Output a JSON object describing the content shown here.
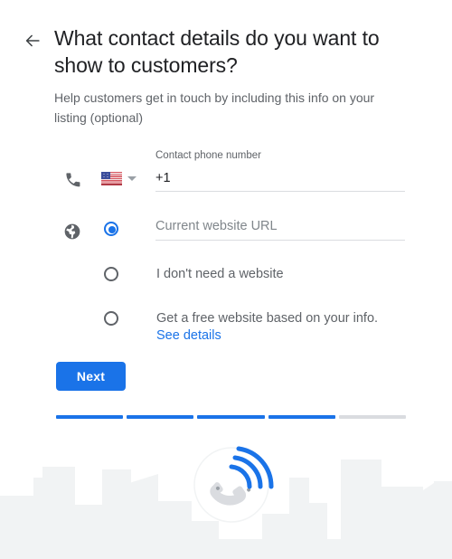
{
  "header": {
    "back_icon": "arrow-left-icon",
    "title": "What contact details do you want to show to customers?",
    "subtitle": "Help customers get in touch by including this info on your listing (optional)"
  },
  "phone": {
    "lead_icon": "phone-icon",
    "country_flag": "us-flag-icon",
    "country_caret": "chevron-down-icon",
    "label": "Contact phone number",
    "value": "+1"
  },
  "website": {
    "lead_icon": "globe-icon",
    "options": [
      {
        "id": "current-url",
        "type": "input",
        "selected": true,
        "placeholder": "Current website URL",
        "label": ""
      },
      {
        "id": "no-website",
        "type": "label",
        "selected": false,
        "label": "I don't need a website"
      },
      {
        "id": "free-website",
        "type": "label-link",
        "selected": false,
        "label": "Get a free website based on your info.",
        "link": "See details"
      }
    ]
  },
  "actions": {
    "next_label": "Next"
  },
  "progress": {
    "total_steps": 5,
    "completed_steps": 4
  },
  "footer": {
    "illustration": "city-skyline-with-phone-call-icon"
  },
  "colors": {
    "accent": "#1a73e8",
    "text_primary": "#202124",
    "text_secondary": "#5f6368",
    "divider": "#dadce0",
    "skyline": "#f1f3f4"
  }
}
